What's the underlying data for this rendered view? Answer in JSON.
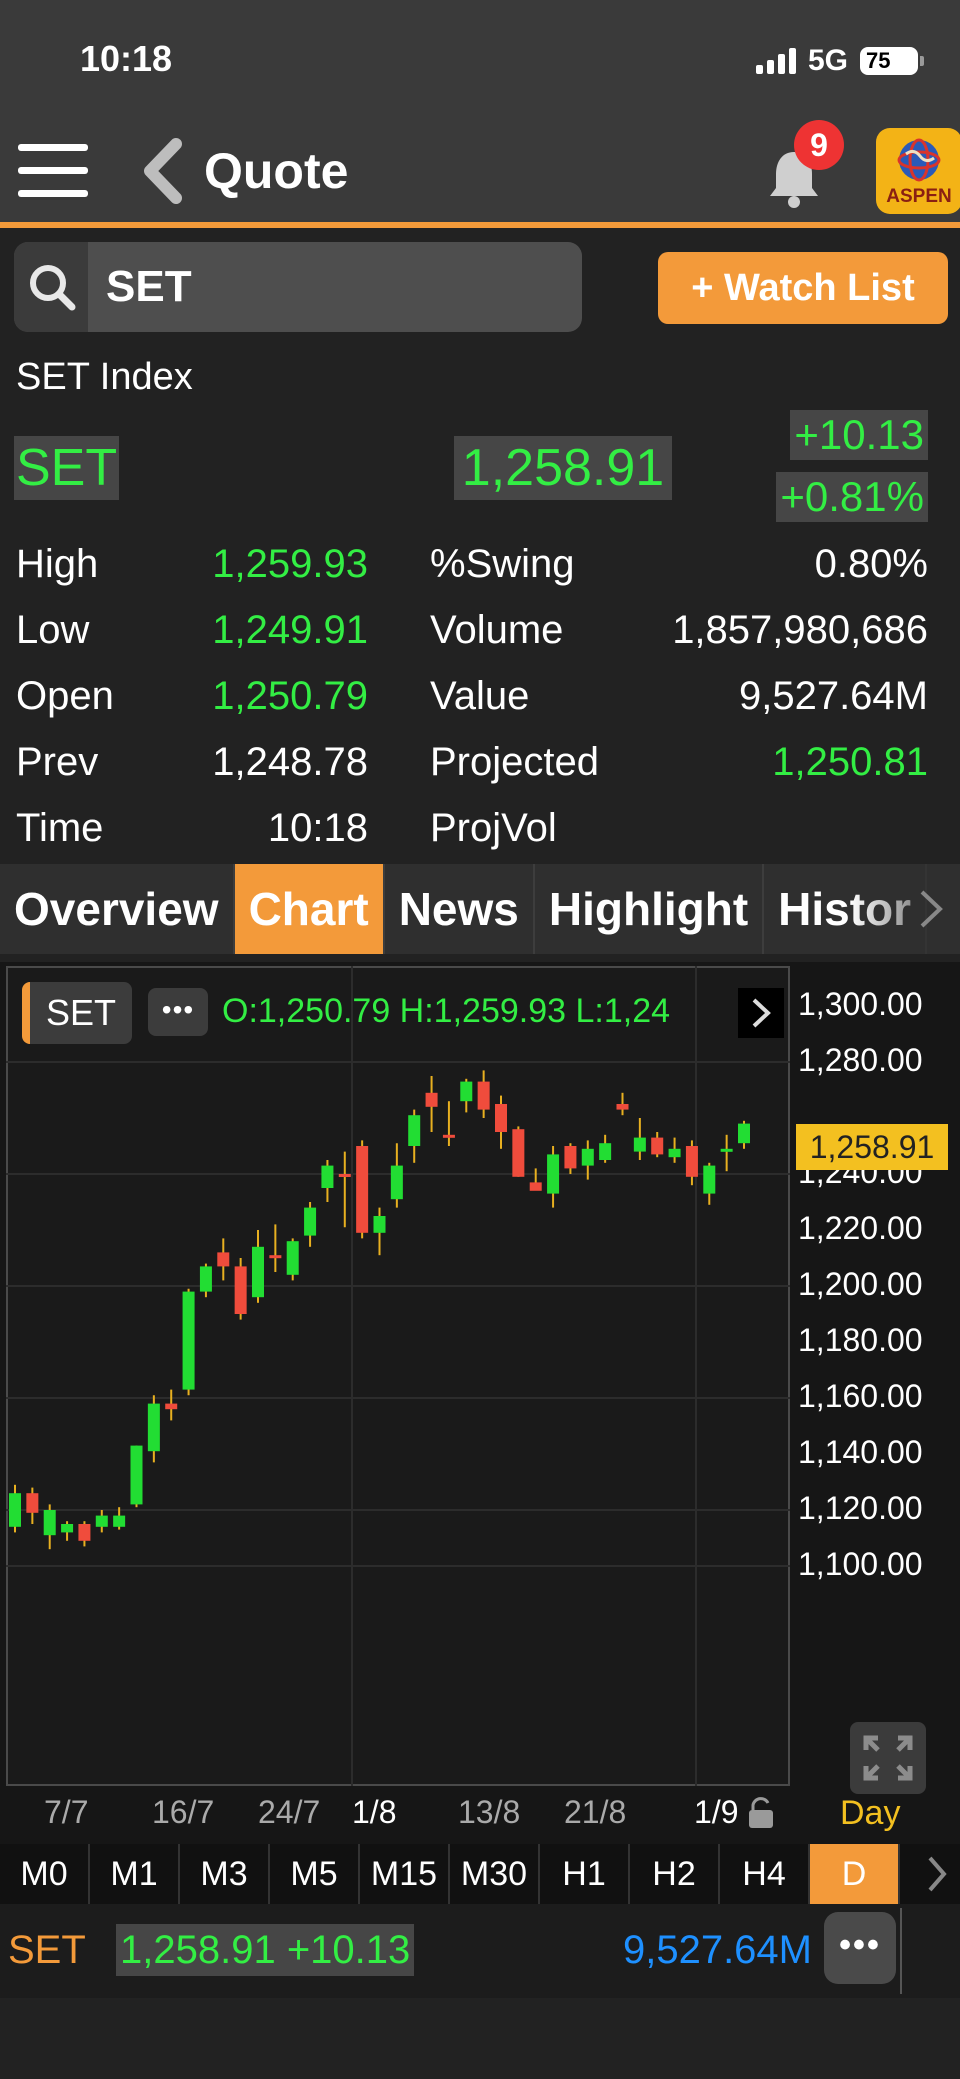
{
  "status": {
    "time": "10:18",
    "network": "5G",
    "battery": "75"
  },
  "nav": {
    "title": "Quote",
    "notifications": "9",
    "logo_text": "ASPEN"
  },
  "search": {
    "value": "SET",
    "watchlist_label": "+ Watch List"
  },
  "quote": {
    "name": "SET Index",
    "symbol": "SET",
    "last": "1,258.91",
    "change": "+10.13",
    "change_pct": "+0.81%",
    "stats_left": [
      {
        "label": "High",
        "value": "1,259.93",
        "color": "green"
      },
      {
        "label": "Low",
        "value": "1,249.91",
        "color": "green"
      },
      {
        "label": "Open",
        "value": "1,250.79",
        "color": "green"
      },
      {
        "label": "Prev",
        "value": "1,248.78",
        "color": "white"
      },
      {
        "label": "Time",
        "value": "10:18",
        "color": "white"
      }
    ],
    "stats_right": [
      {
        "label": "%Swing",
        "value": "0.80%",
        "color": "white"
      },
      {
        "label": "Volume",
        "value": "1,857,980,686",
        "color": "white"
      },
      {
        "label": "Value",
        "value": "9,527.64M",
        "color": "white"
      },
      {
        "label": "Projected",
        "value": "1,250.81",
        "color": "green"
      },
      {
        "label": "ProjVol",
        "value": "",
        "color": "white"
      }
    ]
  },
  "tabs": [
    {
      "label": "Overview",
      "active": false
    },
    {
      "label": "Chart",
      "active": true
    },
    {
      "label": "News",
      "active": false
    },
    {
      "label": "Highlight",
      "active": false
    },
    {
      "label": "Histor",
      "active": false
    }
  ],
  "chart": {
    "symbol": "SET",
    "more_label": "•••",
    "ohlc_text": "O:1,250.79  H:1,259.93  L:1,24",
    "last_price_tag": "1,258.91",
    "period_label": "Day",
    "up_color": "#22dd33",
    "down_color": "#f04c3c"
  },
  "chart_data": {
    "type": "candlestick",
    "ylim": [
      1100,
      1300
    ],
    "yticks": [
      "1,300.00",
      "1,280.00",
      "1,240.00",
      "1,220.00",
      "1,200.00",
      "1,180.00",
      "1,160.00",
      "1,140.00",
      "1,120.00",
      "1,100.00"
    ],
    "xticks": [
      "7/7",
      "16/7",
      "24/7",
      "1/8",
      "13/8",
      "21/8",
      "1/9"
    ],
    "candles": [
      {
        "o": 1114,
        "h": 1129,
        "l": 1112,
        "c": 1126
      },
      {
        "o": 1126,
        "h": 1128,
        "l": 1115,
        "c": 1119
      },
      {
        "o": 1111,
        "h": 1122,
        "l": 1106,
        "c": 1120
      },
      {
        "o": 1112,
        "h": 1116,
        "l": 1109,
        "c": 1115
      },
      {
        "o": 1115,
        "h": 1116,
        "l": 1107,
        "c": 1109
      },
      {
        "o": 1114,
        "h": 1120,
        "l": 1112,
        "c": 1118
      },
      {
        "o": 1114,
        "h": 1121,
        "l": 1113,
        "c": 1118
      },
      {
        "o": 1122,
        "h": 1143,
        "l": 1121,
        "c": 1143
      },
      {
        "o": 1141,
        "h": 1161,
        "l": 1137,
        "c": 1158
      },
      {
        "o": 1158,
        "h": 1163,
        "l": 1152,
        "c": 1156
      },
      {
        "o": 1163,
        "h": 1199,
        "l": 1161,
        "c": 1198
      },
      {
        "o": 1198,
        "h": 1208,
        "l": 1196,
        "c": 1207
      },
      {
        "o": 1212,
        "h": 1217,
        "l": 1202,
        "c": 1207
      },
      {
        "o": 1207,
        "h": 1210,
        "l": 1188,
        "c": 1190
      },
      {
        "o": 1196,
        "h": 1220,
        "l": 1194,
        "c": 1214
      },
      {
        "o": 1211,
        "h": 1222,
        "l": 1205,
        "c": 1210
      },
      {
        "o": 1204,
        "h": 1217,
        "l": 1202,
        "c": 1216
      },
      {
        "o": 1218,
        "h": 1230,
        "l": 1214,
        "c": 1228
      },
      {
        "o": 1235,
        "h": 1245,
        "l": 1230,
        "c": 1243
      },
      {
        "o": 1240,
        "h": 1248,
        "l": 1221,
        "c": 1239
      },
      {
        "o": 1250,
        "h": 1252,
        "l": 1217,
        "c": 1219
      },
      {
        "o": 1219,
        "h": 1228,
        "l": 1211,
        "c": 1225
      },
      {
        "o": 1231,
        "h": 1251,
        "l": 1228,
        "c": 1243
      },
      {
        "o": 1250,
        "h": 1263,
        "l": 1244,
        "c": 1261
      },
      {
        "o": 1269,
        "h": 1275,
        "l": 1255,
        "c": 1264
      },
      {
        "o": 1254,
        "h": 1266,
        "l": 1250,
        "c": 1253
      },
      {
        "o": 1266,
        "h": 1274,
        "l": 1262,
        "c": 1273
      },
      {
        "o": 1273,
        "h": 1277,
        "l": 1260,
        "c": 1263
      },
      {
        "o": 1265,
        "h": 1268,
        "l": 1249,
        "c": 1255
      },
      {
        "o": 1256,
        "h": 1257,
        "l": 1239,
        "c": 1239
      },
      {
        "o": 1237,
        "h": 1242,
        "l": 1236,
        "c": 1234
      },
      {
        "o": 1233,
        "h": 1250,
        "l": 1228,
        "c": 1247
      },
      {
        "o": 1250,
        "h": 1251,
        "l": 1240,
        "c": 1242
      },
      {
        "o": 1243,
        "h": 1252,
        "l": 1238,
        "c": 1249
      },
      {
        "o": 1245,
        "h": 1254,
        "l": 1244,
        "c": 1251
      },
      {
        "o": 1265,
        "h": 1269,
        "l": 1261,
        "c": 1263
      },
      {
        "o": 1248,
        "h": 1260,
        "l": 1245,
        "c": 1253
      },
      {
        "o": 1253,
        "h": 1255,
        "l": 1246,
        "c": 1247
      },
      {
        "o": 1246,
        "h": 1253,
        "l": 1244,
        "c": 1249
      },
      {
        "o": 1250,
        "h": 1252,
        "l": 1236,
        "c": 1239
      },
      {
        "o": 1233,
        "h": 1244,
        "l": 1229,
        "c": 1243
      },
      {
        "o": 1248,
        "h": 1254,
        "l": 1241,
        "c": 1249
      },
      {
        "o": 1251,
        "h": 1259,
        "l": 1249,
        "c": 1258
      }
    ]
  },
  "timeframes": [
    {
      "label": "M0",
      "active": false
    },
    {
      "label": "M1",
      "active": false
    },
    {
      "label": "M3",
      "active": false
    },
    {
      "label": "M5",
      "active": false
    },
    {
      "label": "M15",
      "active": false
    },
    {
      "label": "M30",
      "active": false
    },
    {
      "label": "H1",
      "active": false
    },
    {
      "label": "H2",
      "active": false
    },
    {
      "label": "H4",
      "active": false
    },
    {
      "label": "D",
      "active": true
    }
  ],
  "bottom": {
    "symbol": "SET",
    "price_change": "1,258.91 +10.13",
    "value": "9,527.64M",
    "more_label": "•••"
  }
}
